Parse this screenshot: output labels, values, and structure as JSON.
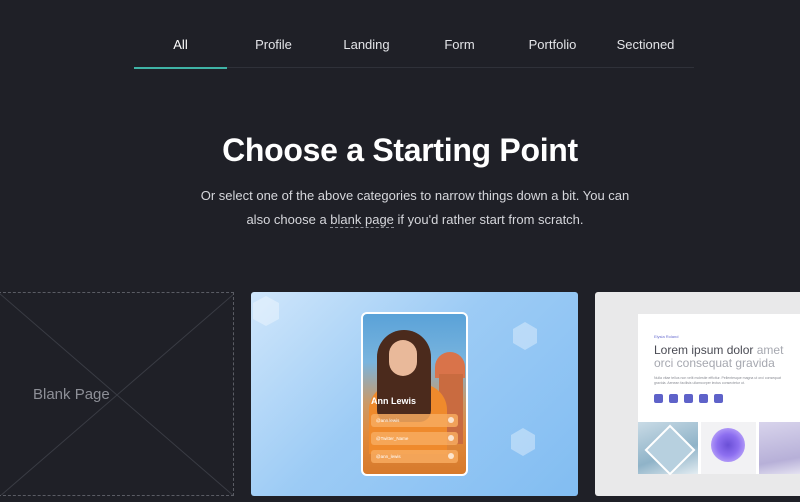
{
  "tabs": [
    {
      "label": "All",
      "active": true
    },
    {
      "label": "Profile",
      "active": false
    },
    {
      "label": "Landing",
      "active": false
    },
    {
      "label": "Form",
      "active": false
    },
    {
      "label": "Portfolio",
      "active": false
    },
    {
      "label": "Sectioned",
      "active": false
    }
  ],
  "hero": {
    "title": "Choose a Starting Point",
    "subtitle_before": "Or select one of the above categories to narrow things down a bit. You can also choose a ",
    "subtitle_link": "blank page",
    "subtitle_after": " if you'd rather start from scratch."
  },
  "cards": {
    "blank": {
      "label": "Blank Page"
    },
    "profile": {
      "name": "Ann Lewis",
      "links": [
        "@ann.lewis",
        "@Twitter_Name",
        "@ann_lewis"
      ]
    },
    "landing": {
      "eyebrow": "Elysia Roland",
      "title_main": "Lorem ipsum dolor",
      "title_muted_1": "amet",
      "title_muted_2": "orci consequat gravida",
      "body": "Nulla vitae tellus non velit molestie efficitur. Pellentesque magna ut orci consequat gravida. Aenean facilisis ullamcorper lectus consectetur ut.",
      "socials": [
        "mail-icon",
        "instagram-icon",
        "facebook-icon",
        "linkedin-icon",
        "youtube-icon"
      ]
    }
  },
  "colors": {
    "background": "#1f2027",
    "tab_accent": "#3fb3a6",
    "profile_gradient_start": "#cfe6fb",
    "profile_gradient_end": "#82bdf2",
    "landing_accent": "#5e62c9"
  }
}
